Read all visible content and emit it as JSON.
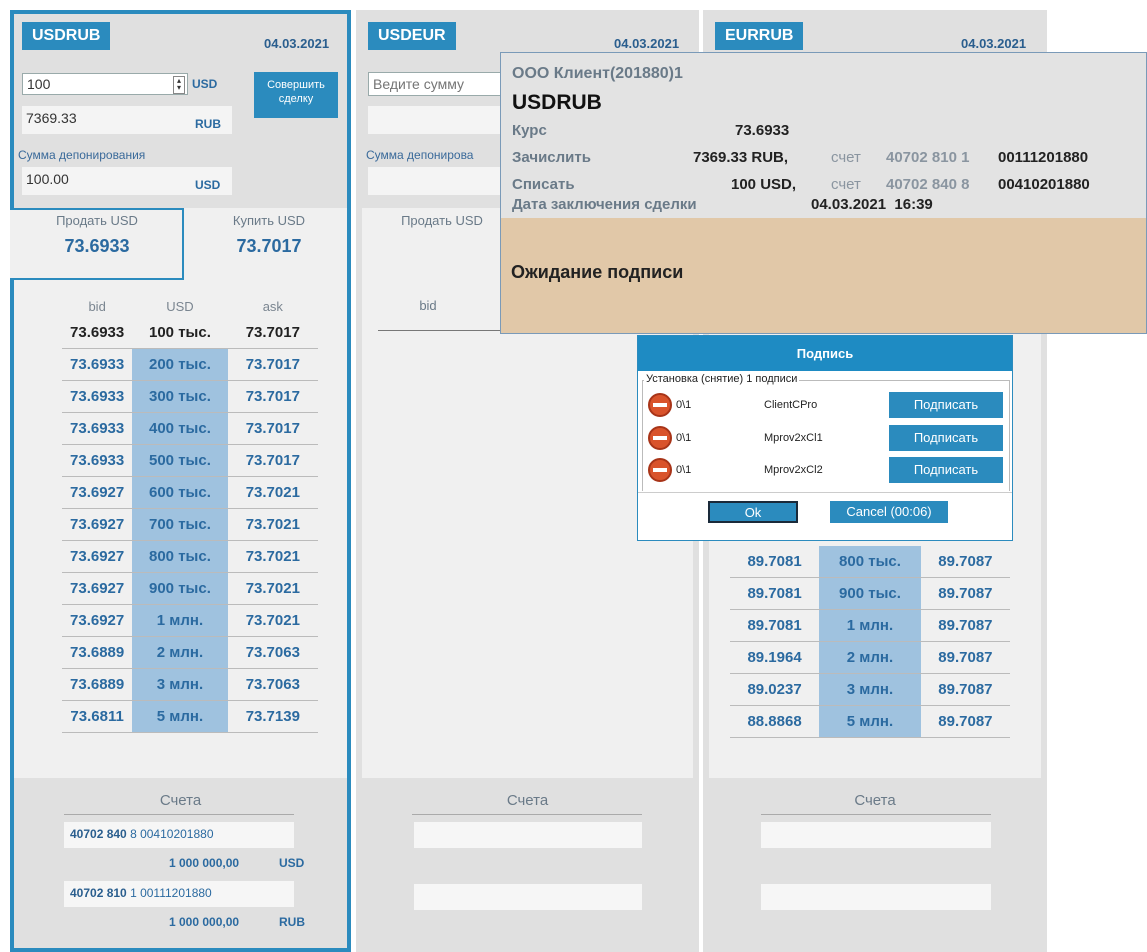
{
  "panels": {
    "usdrub": {
      "pair": "USDRUB",
      "date": "04.03.2021",
      "amount": "100",
      "amount_cur": "USD",
      "deal_button": "Совершить сделку",
      "converted": "7369.33",
      "converted_cur": "RUB",
      "deposit_label": "Сумма депонирования",
      "deposit_value": "100.00",
      "deposit_cur": "USD",
      "sell_label": "Продать USD",
      "sell_price": "73.6933",
      "buy_label": "Купить USD",
      "buy_price": "73.7017",
      "book_headers": [
        "bid",
        "USD",
        "ask"
      ],
      "book": [
        {
          "bid": "73.6933",
          "vol": "100 тыс.",
          "ask": "73.7017"
        },
        {
          "bid": "73.6933",
          "vol": "200 тыс.",
          "ask": "73.7017"
        },
        {
          "bid": "73.6933",
          "vol": "300 тыс.",
          "ask": "73.7017"
        },
        {
          "bid": "73.6933",
          "vol": "400 тыс.",
          "ask": "73.7017"
        },
        {
          "bid": "73.6933",
          "vol": "500 тыс.",
          "ask": "73.7017"
        },
        {
          "bid": "73.6927",
          "vol": "600 тыс.",
          "ask": "73.7021"
        },
        {
          "bid": "73.6927",
          "vol": "700 тыс.",
          "ask": "73.7021"
        },
        {
          "bid": "73.6927",
          "vol": "800 тыс.",
          "ask": "73.7021"
        },
        {
          "bid": "73.6927",
          "vol": "900 тыс.",
          "ask": "73.7021"
        },
        {
          "bid": "73.6927",
          "vol": "1 млн.",
          "ask": "73.7021"
        },
        {
          "bid": "73.6889",
          "vol": "2 млн.",
          "ask": "73.7063"
        },
        {
          "bid": "73.6889",
          "vol": "3 млн.",
          "ask": "73.7063"
        },
        {
          "bid": "73.6811",
          "vol": "5 млн.",
          "ask": "73.7139"
        }
      ],
      "accounts_title": "Счета",
      "acc1_prefix": "40702 840",
      "acc1_rest": "8 00410201880",
      "acc1_balance": "1 000 000,00",
      "acc1_cur": "USD",
      "acc2_prefix": "40702 810",
      "acc2_rest": "1 00111201880",
      "acc2_balance": "1 000 000,00",
      "acc2_cur": "RUB"
    },
    "usdeur": {
      "pair": "USDEUR",
      "date": "04.03.2021",
      "amount_placeholder": "Ведите сумму",
      "deposit_label": "Сумма депонирова",
      "sell_label": "Продать USD",
      "bid_header": "bid",
      "accounts_title": "Счета"
    },
    "eurrub": {
      "pair": "EURRUB",
      "date": "04.03.2021",
      "book": [
        {
          "bid": "89.7081",
          "vol": "800 тыс.",
          "ask": "89.7087"
        },
        {
          "bid": "89.7081",
          "vol": "900 тыс.",
          "ask": "89.7087"
        },
        {
          "bid": "89.7081",
          "vol": "1 млн.",
          "ask": "89.7087"
        },
        {
          "bid": "89.1964",
          "vol": "2 млн.",
          "ask": "89.7087"
        },
        {
          "bid": "89.0237",
          "vol": "3 млн.",
          "ask": "89.7087"
        },
        {
          "bid": "88.8868",
          "vol": "5 млн.",
          "ask": "89.7087"
        }
      ],
      "accounts_title": "Счета"
    }
  },
  "popup": {
    "client": "ООО Клиент(201880)1",
    "pair": "USDRUB",
    "rate_label": "Курс",
    "rate_value": "73.6933",
    "credit_label": "Зачислить",
    "credit_value": "7369.33 RUB,",
    "debit_label": "Списать",
    "debit_value": "100 USD,",
    "account_word": "счет",
    "credit_acc_grey": "40702 810 1",
    "credit_acc_bold": "00111201880",
    "debit_acc_grey": "40702 840 8",
    "debit_acc_bold": "00410201880",
    "date_label": "Дата заключения сделки",
    "date_value": "04.03.2021  16:39",
    "status": "Ожидание подписи"
  },
  "dialog": {
    "title": "Подпись",
    "group_label": "Установка (снятие) 1 подписи",
    "rows": [
      {
        "count": "0\\1",
        "name": "ClientCPro",
        "button": "Подписать"
      },
      {
        "count": "0\\1",
        "name": "Mprov2xCl1",
        "button": "Подписать"
      },
      {
        "count": "0\\1",
        "name": "Mprov2xCl2",
        "button": "Подписать"
      }
    ],
    "ok": "Ok",
    "cancel": "Cancel (00:06)"
  },
  "colors": {
    "accent": "#2b8bbe",
    "status_bg": "#e1c8a8",
    "highlight": "#9fc2df"
  }
}
